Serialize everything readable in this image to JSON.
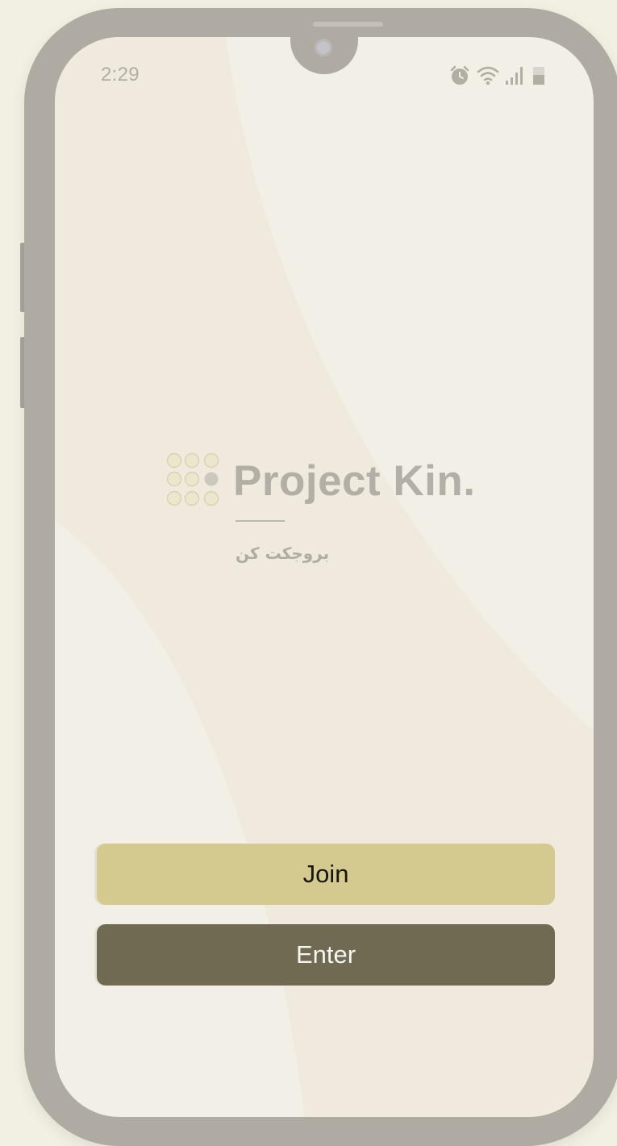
{
  "status_bar": {
    "time": "2:29",
    "icons": [
      "alarm-icon",
      "wifi-icon",
      "signal-icon",
      "battery-icon"
    ]
  },
  "brand": {
    "title": "Project Kin.",
    "subtitle_arabic": "بروجكت كن",
    "logo": "nine-dot-grid-icon"
  },
  "actions": {
    "join_label": "Join",
    "enter_label": "Enter"
  },
  "colors": {
    "background": "#f2efe3",
    "phone_frame": "#afaba2",
    "join_button": "#d4c98f",
    "enter_button": "#706a52",
    "brand_text": "#b3afa6"
  }
}
